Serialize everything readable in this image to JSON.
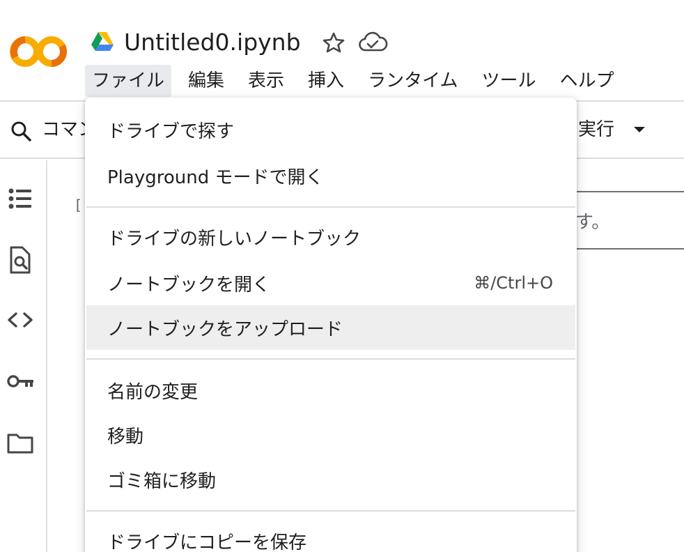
{
  "header": {
    "title": "Untitled0.ipynb",
    "logo_icon": "colab-logo-icon",
    "drive_icon": "google-drive-icon",
    "star_icon": "star-outline-icon",
    "cloud_icon": "cloud-saved-icon"
  },
  "menubar": {
    "items": [
      {
        "label": "ファイル",
        "active": true
      },
      {
        "label": "編集"
      },
      {
        "label": "表示"
      },
      {
        "label": "挿入"
      },
      {
        "label": "ランタイム"
      },
      {
        "label": "ツール"
      },
      {
        "label": "ヘルプ"
      }
    ]
  },
  "toolbar": {
    "command_label": "コマン",
    "run_label": "実行"
  },
  "cell": {
    "bracket": "[",
    "partial_text": "す。"
  },
  "file_menu": {
    "items": [
      {
        "label": "ドライブで探す",
        "shortcut": ""
      },
      {
        "label": "Playground モードで開く",
        "shortcut": ""
      },
      {
        "label": "ドライブの新しいノートブック",
        "shortcut": ""
      },
      {
        "label": "ノートブックを開く",
        "shortcut": "⌘/Ctrl+O"
      },
      {
        "label": "ノートブックをアップロード",
        "shortcut": "",
        "highlighted": true
      },
      {
        "label": "名前の変更",
        "shortcut": ""
      },
      {
        "label": "移動",
        "shortcut": ""
      },
      {
        "label": "ゴミ箱に移動",
        "shortcut": ""
      },
      {
        "label": "ドライブにコピーを保存",
        "shortcut": ""
      }
    ]
  },
  "colors": {
    "logo_orange": "#F9AB00",
    "logo_dark_orange": "#E8710A",
    "hover_bg": "#eeeeee",
    "active_menu_bg": "#e8eaed"
  }
}
